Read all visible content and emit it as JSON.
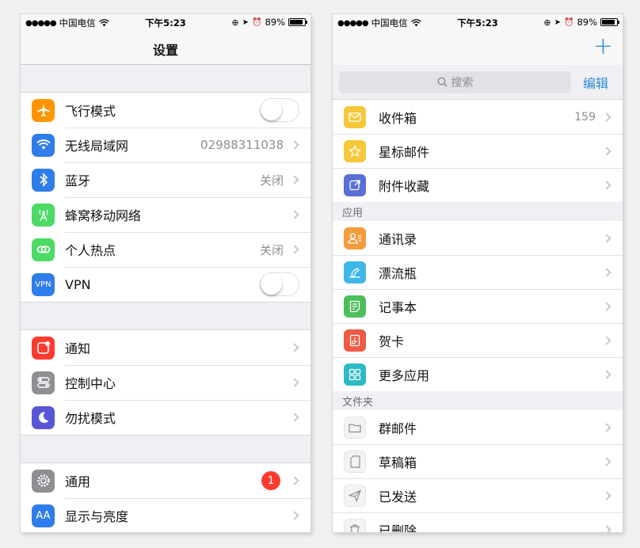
{
  "status_bar": {
    "carrier": "中国电信",
    "time": "下午5:23",
    "battery": "89%",
    "battery_level": 0.89
  },
  "settings_screen": {
    "title": "设置",
    "groups": [
      [
        {
          "label": "飞行模式",
          "icon": "airplane-icon",
          "color": "#ff9500",
          "accessory": "toggle",
          "toggle_on": false
        },
        {
          "label": "无线局域网",
          "icon": "wifi-icon",
          "color": "#2f7dea",
          "detail": "02988311038",
          "accessory": "chevron"
        },
        {
          "label": "蓝牙",
          "icon": "bluetooth-icon",
          "color": "#2f7dea",
          "detail": "关闭",
          "accessory": "chevron"
        },
        {
          "label": "蜂窝移动网络",
          "icon": "cellular-icon",
          "color": "#4cd964",
          "accessory": "chevron"
        },
        {
          "label": "个人热点",
          "icon": "hotspot-icon",
          "color": "#4cd964",
          "detail": "关闭",
          "accessory": "chevron"
        },
        {
          "label": "VPN",
          "icon": "vpn-icon",
          "icon_text": "VPN",
          "color": "#2f7dea",
          "accessory": "toggle",
          "toggle_on": false
        }
      ],
      [
        {
          "label": "通知",
          "icon": "notifications-icon",
          "color": "#ff3b30",
          "accessory": "chevron"
        },
        {
          "label": "控制中心",
          "icon": "control-center-icon",
          "color": "#8e8e93",
          "accessory": "chevron"
        },
        {
          "label": "勿扰模式",
          "icon": "moon-icon",
          "color": "#5856d6",
          "accessory": "chevron"
        }
      ],
      [
        {
          "label": "通用",
          "icon": "gear-icon",
          "color": "#8e8e93",
          "badge": "1",
          "accessory": "chevron"
        },
        {
          "label": "显示与亮度",
          "icon": "display-icon",
          "icon_text": "AA",
          "color": "#2f7dea",
          "accessory": "chevron"
        }
      ]
    ]
  },
  "mail_screen": {
    "search_placeholder": "搜索",
    "edit_label": "编辑",
    "mailboxes": [
      {
        "label": "收件箱",
        "icon": "inbox-icon",
        "color": "#f5c83a",
        "count": "159"
      },
      {
        "label": "星标邮件",
        "icon": "star-icon",
        "color": "#f5c83a"
      },
      {
        "label": "附件收藏",
        "icon": "attachment-icon",
        "color": "#5b6fd6"
      }
    ],
    "apps_header": "应用",
    "apps": [
      {
        "label": "通讯录",
        "icon": "contacts-icon",
        "color": "#f39c3d"
      },
      {
        "label": "漂流瓶",
        "icon": "bottle-icon",
        "color": "#3fb8e8"
      },
      {
        "label": "记事本",
        "icon": "notepad-icon",
        "color": "#4cbf5a"
      },
      {
        "label": "贺卡",
        "icon": "card-icon",
        "color": "#ee5a45"
      },
      {
        "label": "更多应用",
        "icon": "more-apps-icon",
        "color": "#2bbbc4"
      }
    ],
    "folders_header": "文件夹",
    "folders": [
      {
        "label": "群邮件",
        "icon": "folder-icon"
      },
      {
        "label": "草稿箱",
        "icon": "draft-icon"
      },
      {
        "label": "已发送",
        "icon": "sent-icon"
      },
      {
        "label": "已删除",
        "icon": "trash-icon"
      }
    ]
  }
}
